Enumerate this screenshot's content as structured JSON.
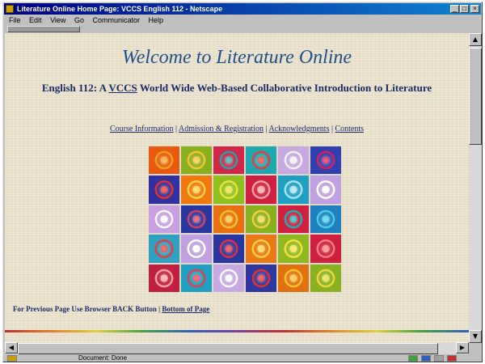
{
  "window": {
    "title": "Literature Online Home Page: VCCS English 112 - Netscape",
    "minimize": "_",
    "maximize": "□",
    "close": "×"
  },
  "menu": [
    "File",
    "Edit",
    "View",
    "Go",
    "Communicator",
    "Help"
  ],
  "page": {
    "heading": "Welcome to Literature Online",
    "subtitle_prefix": "English 112: A",
    "subtitle_link": "VCCS",
    "subtitle_suffix": "World Wide Web-Based Collaborative Introduction to Literature",
    "nav_links": [
      "Course Information",
      "Admission & Registration",
      "Acknowledgments",
      "Contents"
    ],
    "nav_separator": "|",
    "footer_text": "For Previous Page Use Browser BACK Button",
    "footer_link": "Bottom of Page"
  },
  "quilt": {
    "rows": [
      [
        [
          "#e85a10",
          "#f0a020"
        ],
        [
          "#88b020",
          "#f6c030"
        ],
        [
          "#d0284a",
          "#30a0a0"
        ],
        [
          "#20a8b0",
          "#e04040"
        ],
        [
          "#c8a8e0",
          "#f0f0f0"
        ],
        [
          "#3040b0",
          "#d02060"
        ]
      ],
      [
        [
          "#3030a0",
          "#e03030"
        ],
        [
          "#f07810",
          "#f8d040"
        ],
        [
          "#90c020",
          "#e8e040"
        ],
        [
          "#d02040",
          "#f0a0a0"
        ],
        [
          "#20a0c0",
          "#a0e0f0"
        ],
        [
          "#c0a0e0",
          "#ffffff"
        ]
      ],
      [
        [
          "#c8a0e0",
          "#f8f8ff"
        ],
        [
          "#2838a0",
          "#d04060"
        ],
        [
          "#e87010",
          "#f0c030"
        ],
        [
          "#88b020",
          "#f0d040"
        ],
        [
          "#d02040",
          "#20b0b0"
        ],
        [
          "#2080c0",
          "#40d0e0"
        ]
      ],
      [
        [
          "#30a0c0",
          "#e04040"
        ],
        [
          "#c0a0e0",
          "#ffffff"
        ],
        [
          "#2838a0",
          "#e03040"
        ],
        [
          "#e87818",
          "#f8d040"
        ],
        [
          "#90b820",
          "#f0e040"
        ],
        [
          "#d02040",
          "#f08080"
        ]
      ],
      [
        [
          "#c02040",
          "#f0a0a0"
        ],
        [
          "#20a0c0",
          "#e04050"
        ],
        [
          "#c8a8e0",
          "#f8f8ff"
        ],
        [
          "#3038a0",
          "#e03030"
        ],
        [
          "#e07010",
          "#f8c030"
        ],
        [
          "#88b020",
          "#e8d840"
        ]
      ]
    ]
  },
  "status": {
    "text": "Document: Done"
  }
}
